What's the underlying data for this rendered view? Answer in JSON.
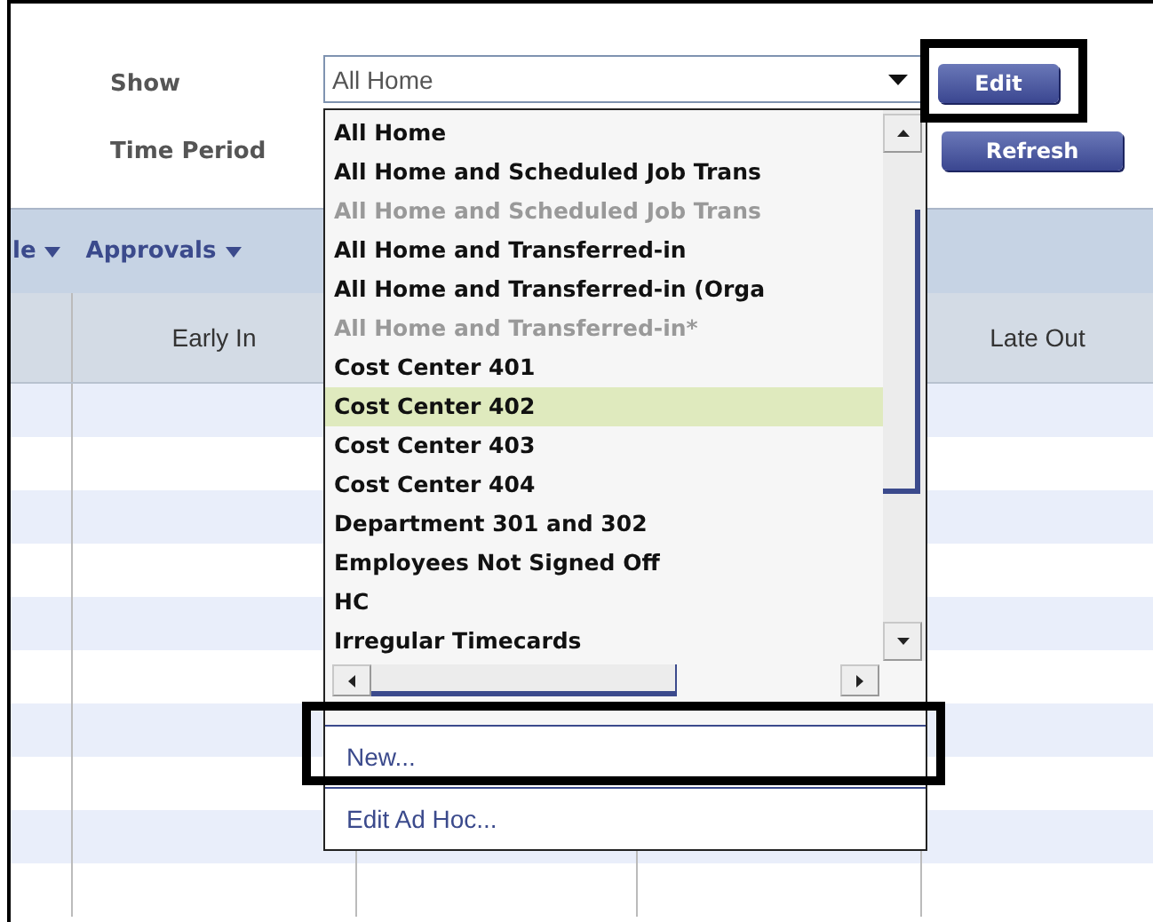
{
  "filters": [
    {
      "label": "Show"
    },
    {
      "label": "Time Period"
    }
  ],
  "show_select": {
    "value": "All Home"
  },
  "buttons": [
    {
      "label": "Edit"
    },
    {
      "label": "Refresh"
    }
  ],
  "menus": [
    {
      "label": "le"
    },
    {
      "label": "Approvals"
    }
  ],
  "table": {
    "columns": [
      {
        "label": "Early In"
      },
      {
        "label": "Late Out"
      }
    ]
  },
  "dropdown": {
    "items": [
      {
        "label": "All Home",
        "disabled": false,
        "selected": false
      },
      {
        "label": "All Home and Scheduled Job Trans",
        "disabled": false,
        "selected": false
      },
      {
        "label": "All Home and Scheduled Job Trans",
        "disabled": true,
        "selected": false
      },
      {
        "label": "All Home and Transferred-in",
        "disabled": false,
        "selected": false
      },
      {
        "label": "All Home and Transferred-in (Orga",
        "disabled": false,
        "selected": false
      },
      {
        "label": "All Home and Transferred-in*",
        "disabled": true,
        "selected": false
      },
      {
        "label": "Cost Center 401",
        "disabled": false,
        "selected": false
      },
      {
        "label": "Cost Center 402",
        "disabled": false,
        "selected": true
      },
      {
        "label": "Cost Center 403",
        "disabled": false,
        "selected": false
      },
      {
        "label": "Cost Center 404",
        "disabled": false,
        "selected": false
      },
      {
        "label": "Department 301 and 302",
        "disabled": false,
        "selected": false
      },
      {
        "label": "Employees Not Signed Off",
        "disabled": false,
        "selected": false
      },
      {
        "label": "HC",
        "disabled": false,
        "selected": false
      },
      {
        "label": "Irregular Timecards",
        "disabled": false,
        "selected": false
      }
    ],
    "actions": [
      {
        "label": "New..."
      },
      {
        "label": "Edit Ad Hoc..."
      }
    ]
  }
}
